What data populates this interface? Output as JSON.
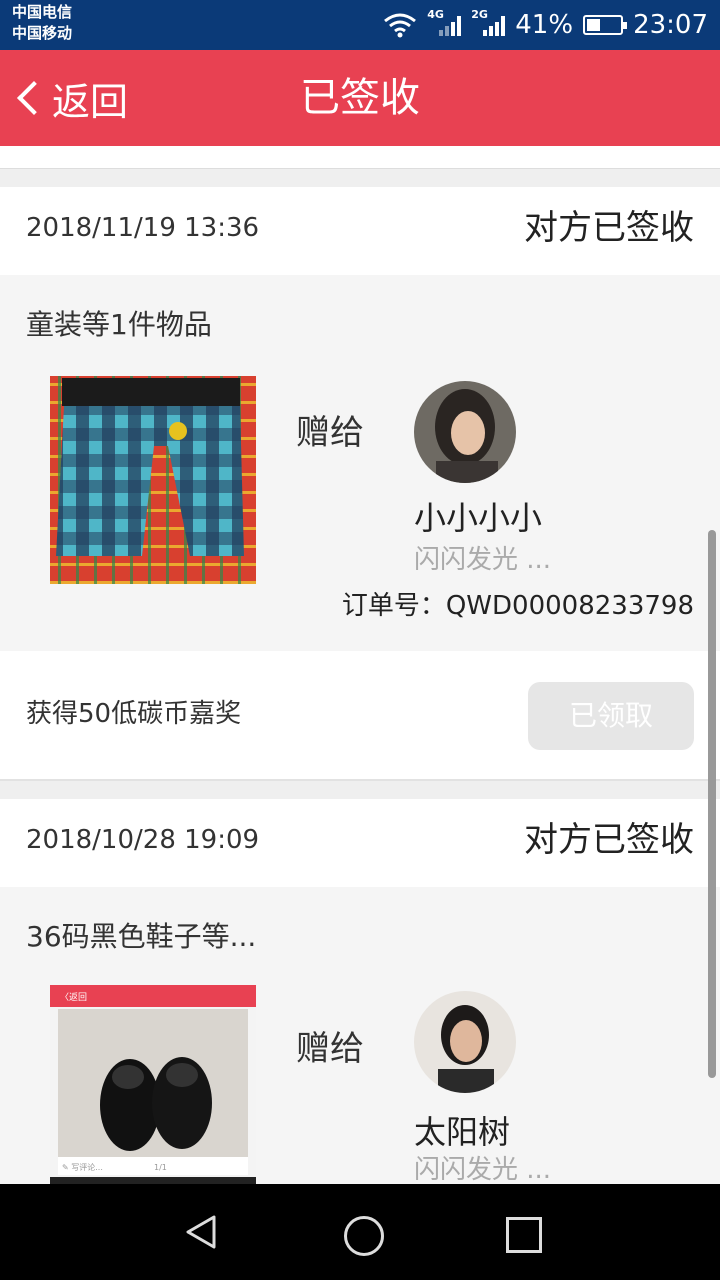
{
  "status_bar": {
    "carrier1": "中国电信",
    "carrier2": "中国移动",
    "net1": "4G",
    "net2": "2G",
    "battery": "41%",
    "battery_level": 0.41,
    "time": "23:07"
  },
  "header": {
    "back_label": "返回",
    "title": "已签收"
  },
  "orders": [
    {
      "date": "2018/11/19 13:36",
      "status": "对方已签收",
      "goods": "童装等1件物品",
      "give_label": "赠给",
      "recipient_name": "小小小小",
      "recipient_sub": "闪闪发光 ...",
      "order_no": "订单号：QWD00008233798",
      "reward_text": "获得50低碳币嘉奖",
      "reward_button": "已领取"
    },
    {
      "date": "2018/10/28 19:09",
      "status": "对方已签收",
      "goods": "36码黑色鞋子等...",
      "give_label": "赠给",
      "recipient_name": "太阳树",
      "recipient_sub": "闪闪发光 ...",
      "thumb_ui": {
        "back": "〈返回",
        "bottom": "✎ 写评论...",
        "page": "1/1"
      }
    }
  ],
  "icons": {
    "wifi": "wifi-icon",
    "back": "chevron-left-icon",
    "nav_back": "triangle-back-icon",
    "nav_home": "circle-home-icon",
    "nav_recent": "square-recent-icon"
  }
}
